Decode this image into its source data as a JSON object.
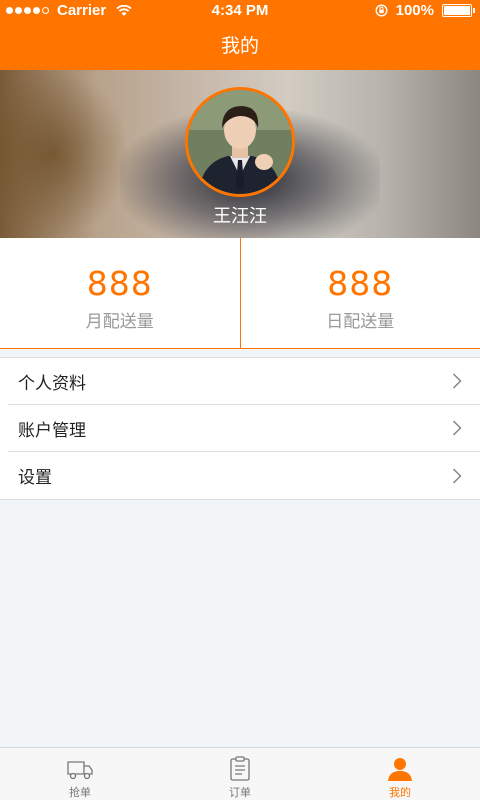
{
  "status_bar": {
    "carrier": "Carrier",
    "time": "4:34 PM",
    "battery": "100%"
  },
  "nav": {
    "title": "我的"
  },
  "profile": {
    "name": "王汪汪"
  },
  "stats": [
    {
      "value": "888",
      "label": "月配送量"
    },
    {
      "value": "888",
      "label": "日配送量"
    }
  ],
  "menu": [
    {
      "label": "个人资料"
    },
    {
      "label": "账户管理"
    },
    {
      "label": "设置"
    }
  ],
  "tabs": [
    {
      "label": "抢单",
      "icon": "truck-icon"
    },
    {
      "label": "订单",
      "icon": "clipboard-icon"
    },
    {
      "label": "我的",
      "icon": "user-icon"
    }
  ],
  "colors": {
    "accent": "#ff7500",
    "background": "#f2f5f7"
  }
}
